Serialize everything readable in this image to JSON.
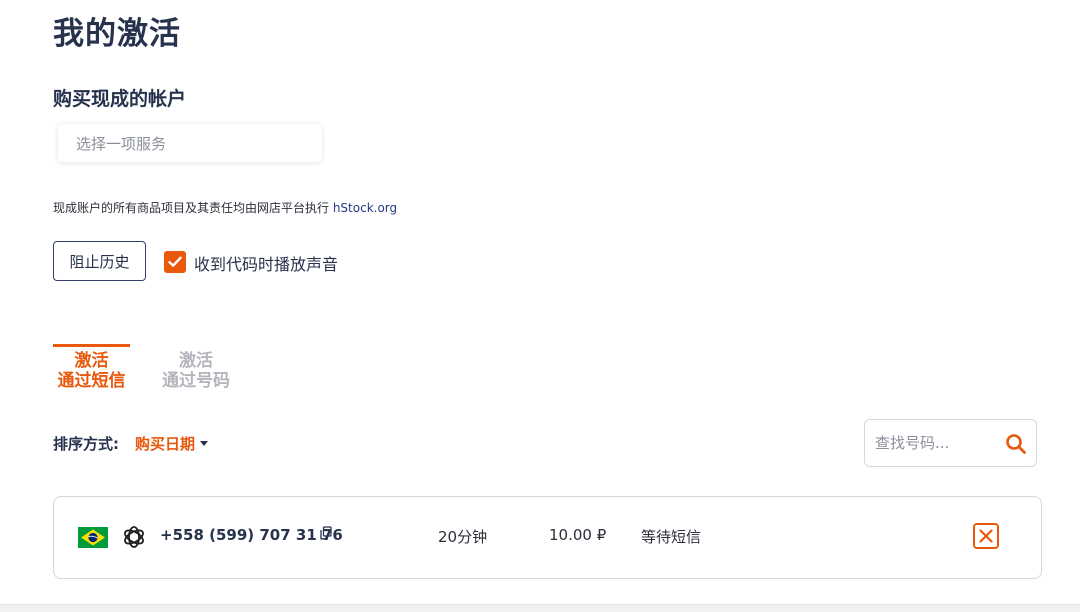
{
  "page": {
    "title": "我的激活"
  },
  "buy_section": {
    "title": "购买现成的帐户",
    "service_placeholder": "选择一项服务",
    "note_text": "现成账户的所有商品项目及其责任均由网店平台执行 ",
    "note_link": "hStock.org"
  },
  "controls": {
    "history_button": "阻止历史",
    "sound_label": "收到代码时播放声音",
    "sound_checked": true
  },
  "tabs": [
    {
      "line1": "激活",
      "line2": "通过短信",
      "active": true
    },
    {
      "line1": "激活",
      "line2": "通过号码",
      "active": false
    }
  ],
  "sort": {
    "label": "排序方式:",
    "value": "购买日期"
  },
  "search": {
    "placeholder": "查找号码..."
  },
  "activations": [
    {
      "country_flag": "brazil-flag-icon",
      "service_icon": "openai-icon",
      "phone": "+558 (599) 707 31 76",
      "duration": "20分钟",
      "price": "10.00 ₽",
      "status": "等待短信"
    }
  ],
  "colors": {
    "accent": "#e8590c",
    "text_dark": "#27324d",
    "link": "#243b84",
    "brazil_green": "#009c3b",
    "brazil_yellow": "#ffdf00",
    "brazil_blue": "#002776"
  }
}
